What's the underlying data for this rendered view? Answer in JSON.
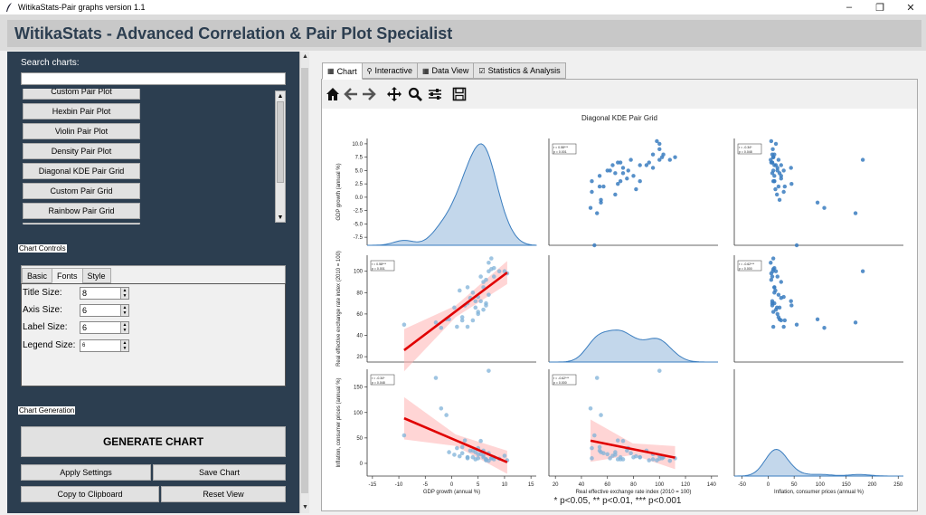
{
  "window": {
    "title": "WitikaStats-Pair graphs version 1.1",
    "min_icon": "minimize-icon",
    "max_icon": "restore-icon",
    "close_icon": "close-icon"
  },
  "header": {
    "title": "WitikaStats - Advanced Correlation & Pair Plot Specialist"
  },
  "sidebar": {
    "search_label": "Search charts:",
    "search_value": "",
    "chart_types": [
      "Custom Pair Plot",
      "Hexbin Pair Plot",
      "Violin Pair Plot",
      "Density Pair Plot",
      "Diagonal KDE Pair Grid",
      "Custom Pair Grid",
      "Rainbow Pair Grid"
    ],
    "controls_label": "Chart Controls",
    "tabs": [
      "Basic",
      "Fonts",
      "Style"
    ],
    "active_tab": "Fonts",
    "fields": [
      {
        "label": "Title Size:",
        "value": "8"
      },
      {
        "label": "Axis Size:",
        "value": "6"
      },
      {
        "label": "Label Size:",
        "value": "6"
      },
      {
        "label": "Legend Size:",
        "value": "6"
      }
    ],
    "generation_label": "Chart Generation",
    "generate_label": "GENERATE CHART",
    "apply_label": "Apply Settings",
    "save_label": "Save Chart",
    "copy_label": "Copy to Clipboard",
    "reset_label": "Reset View"
  },
  "main_tabs": [
    {
      "label": "Chart",
      "icon": "chart-tab-icon"
    },
    {
      "label": "Interactive",
      "icon": "magnifier-tab-icon"
    },
    {
      "label": "Data View",
      "icon": "table-tab-icon"
    },
    {
      "label": "Statistics & Analysis",
      "icon": "stats-tab-icon"
    }
  ],
  "active_main_tab": "Chart",
  "toolbar_icons": [
    "home-icon",
    "back-arrow-icon",
    "forward-arrow-icon",
    "pan-icon",
    "zoom-icon",
    "configure-subplots-icon",
    "save-icon"
  ],
  "chart_data": {
    "type": "scatter",
    "title": "Diagonal KDE Pair Grid",
    "footnote": "* p<0.05, ** p<0.01, *** p<0.001",
    "variables": [
      "GDP growth (annual %)",
      "Real effective exchange rate index (2010 = 100)",
      "Inflation, consumer prices (annual %)"
    ],
    "xticks": [
      [
        -15,
        -10,
        -5,
        0,
        5,
        10,
        15
      ],
      [
        20,
        40,
        60,
        80,
        100,
        120,
        140
      ],
      [
        -50,
        0,
        50,
        100,
        150,
        200,
        250
      ]
    ],
    "yticks": [
      [
        -7.5,
        -5.0,
        -2.5,
        0.0,
        2.5,
        5.0,
        7.5,
        10.0
      ],
      [
        20,
        40,
        60,
        80,
        100
      ],
      [
        0,
        50,
        100,
        150
      ]
    ],
    "xlim": [
      [
        -16,
        16
      ],
      [
        15,
        145
      ],
      [
        -65,
        260
      ]
    ],
    "ylim": [
      [
        -9,
        11
      ],
      [
        15,
        115
      ],
      [
        -25,
        185
      ]
    ],
    "corr_labels": {
      "0_1": [
        "r = 0.58***",
        "p = 0.001"
      ],
      "0_2": [
        "r = -0.34*",
        "p = 0.048"
      ],
      "1_0": [
        "r = 0.58***",
        "p = 0.001"
      ],
      "1_2": [
        "r = -0.62***",
        "p = 0.000"
      ],
      "2_0": [
        "r = -0.34*",
        "p = 0.048"
      ],
      "2_1": [
        "r = -0.62***",
        "p = 0.000"
      ]
    },
    "points": {
      "gdp": [
        -9,
        -3,
        -2,
        -1,
        -0.5,
        0.5,
        1,
        2,
        2.5,
        3,
        3.5,
        4,
        4.5,
        5,
        5,
        5.5,
        5.5,
        6,
        6,
        6.5,
        6.5,
        7,
        7,
        7,
        7.5,
        8,
        8,
        9,
        10,
        10.5,
        5,
        4,
        3,
        6,
        2,
        1.5,
        7.5,
        4.5,
        6.5,
        3
      ],
      "reer": [
        50,
        52,
        47,
        55,
        55,
        66,
        48,
        54,
        68,
        70,
        75,
        80,
        72,
        76,
        62,
        72,
        95,
        90,
        85,
        70,
        92,
        100,
        108,
        78,
        102,
        103,
        95,
        100,
        100,
        98,
        60,
        54,
        48,
        64,
        57,
        82,
        112,
        66,
        68,
        85
      ],
      "infl": [
        55,
        168,
        108,
        95,
        22,
        17,
        30,
        32,
        45,
        12,
        25,
        12,
        8,
        30,
        10,
        44,
        18,
        25,
        12,
        8,
        6,
        182,
        5,
        20,
        10,
        12,
        8,
        9,
        15,
        6,
        18,
        25,
        10,
        15,
        20,
        14,
        10,
        22,
        8,
        12
      ]
    }
  }
}
